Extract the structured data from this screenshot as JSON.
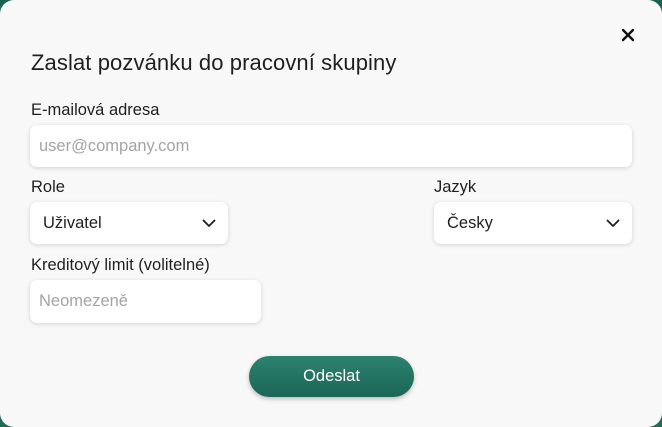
{
  "dialog": {
    "title": "Zaslat pozvánku do pracovní skupiny",
    "close_icon": "close-icon"
  },
  "email": {
    "label": "E-mailová adresa",
    "value": "",
    "placeholder": "user@company.com"
  },
  "role": {
    "label": "Role",
    "selected": "Uživatel"
  },
  "language": {
    "label": "Jazyk",
    "selected": "Česky"
  },
  "credit_limit": {
    "label": "Kreditový limit (volitelné)",
    "value": "",
    "placeholder": "Neomezeně"
  },
  "actions": {
    "submit_label": "Odeslat"
  },
  "colors": {
    "accent": "#1f6b57",
    "dialog_background": "#f8f8f8"
  }
}
